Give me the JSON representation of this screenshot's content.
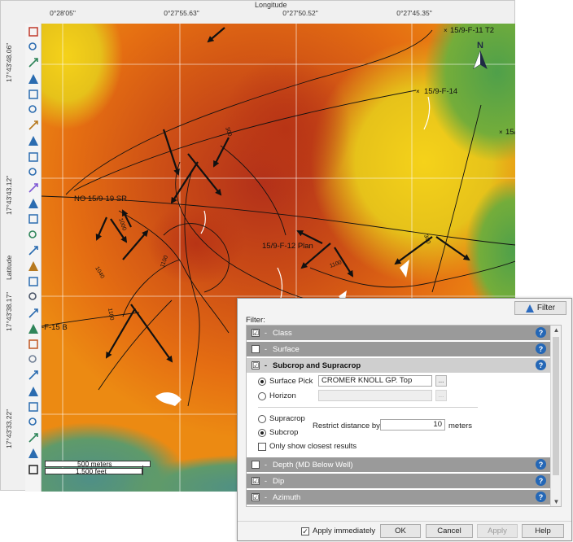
{
  "map": {
    "x_axis_title": "Longitude",
    "y_axis_title": "Latitude",
    "x_ticks": [
      "0°28'05\"",
      "0°27'55.63\"",
      "0°27'50.52\"",
      "0°27'45.35\""
    ],
    "y_ticks": [
      "17°43'48.06\"",
      "17°43'43.12\"",
      "17°43'38.17\"",
      "17°43'33.22\""
    ],
    "north_label": "N",
    "well_labels": [
      "15/9-F-11 T2",
      "15/9-F-14",
      "15/",
      "NO 15/9-19 SR",
      "15/9-F-12 Plan",
      "-F-15 B"
    ],
    "scale": {
      "metric": "500 meters",
      "imperial": "1,500 feet"
    },
    "colors": {
      "high": "#b83415",
      "mid": "#e07a12",
      "low": "#f2c21a",
      "green": "#4e9f4a",
      "teal": "#4f8f86"
    }
  },
  "toolbar": {
    "tools": [
      "close-arrows-icon",
      "select-icon",
      "grid-icon",
      "pan-icon",
      "zoom-in-icon",
      "zoom-out-icon",
      "zoom-box-icon",
      "zoom-extent-icon",
      "zoom-selection-icon",
      "refresh-icon",
      "measure-icon",
      "cross-section-icon",
      "draw-line-icon",
      "polygon-icon",
      "well-path-icon",
      "pencil-icon",
      "layers-icon",
      "settings-icon",
      "ruler-icon",
      "contour-icon",
      "chart-icon",
      "points-icon",
      "plus-icon",
      "split-icon",
      "grid-lines-icon",
      "link-icon",
      "check-icon",
      "legend-icon",
      "expand-icon"
    ]
  },
  "filter_dialog": {
    "toggle_label": "Filter",
    "heading": "Filter:",
    "sections": [
      {
        "title": "Class",
        "checked": "☑"
      },
      {
        "title": "Surface",
        "checked": ""
      },
      {
        "title": "Subcrop and Supracrop",
        "checked": "☑"
      },
      {
        "title": "Depth (MD Below Well)",
        "checked": ""
      },
      {
        "title": "Dip",
        "checked": "☑"
      },
      {
        "title": "Azimuth",
        "checked": "☑"
      }
    ],
    "subcrop": {
      "surface_pick_label": "Surface Pick",
      "surface_pick_value": "CROMER KNOLL GP. Top",
      "horizon_label": "Horizon",
      "horizon_value": "",
      "browse_label": "...",
      "supracrop_label": "Supracrop",
      "subcrop_label": "Subcrop",
      "restrict_label": "Restrict distance by",
      "restrict_value": "10",
      "restrict_unit": "meters",
      "closest_label": "Only show closest results"
    },
    "footer": {
      "apply_immediately": "Apply immediately",
      "ok": "OK",
      "cancel": "Cancel",
      "apply": "Apply",
      "help": "Help"
    }
  }
}
